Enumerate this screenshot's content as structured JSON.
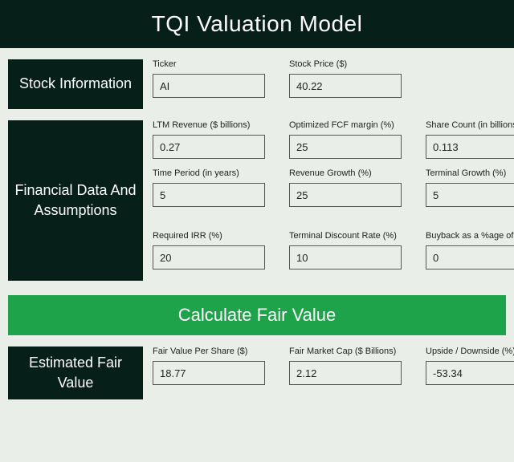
{
  "header": {
    "title": "TQI Valuation Model"
  },
  "sections": {
    "stock": {
      "label": "Stock Information",
      "ticker_label": "Ticker",
      "ticker_value": "AI",
      "price_label": "Stock Price ($)",
      "price_value": "40.22"
    },
    "fin": {
      "label": "Financial Data And Assumptions",
      "ltm_label": "LTM Revenue ($ billions)",
      "ltm_value": "0.27",
      "fcf_label": "Optimized FCF margin (%)",
      "fcf_value": "25",
      "shares_label": "Share Count (in billions)",
      "shares_value": "0.113",
      "period_label": "Time Period (in years)",
      "period_value": "5",
      "revgrowth_label": "Revenue Growth (%)",
      "revgrowth_value": "25",
      "termgrowth_label": "Terminal Growth (%)",
      "termgrowth_value": "5",
      "irr_label": "Required IRR (%)",
      "irr_value": "20",
      "termdisc_label": "Terminal Discount Rate (%)",
      "termdisc_value": "10",
      "buyback_label": "Buyback as a %age of FCF",
      "buyback_value": "0"
    },
    "est": {
      "label": "Estimated Fair Value",
      "fvps_label": "Fair Value Per Share ($)",
      "fvps_value": "18.77",
      "fmc_label": "Fair Market Cap ($ Billions)",
      "fmc_value": "2.12",
      "upside_label": "Upside / Downside (%)",
      "upside_value": "-53.34"
    }
  },
  "button": {
    "calc": "Calculate Fair Value"
  }
}
